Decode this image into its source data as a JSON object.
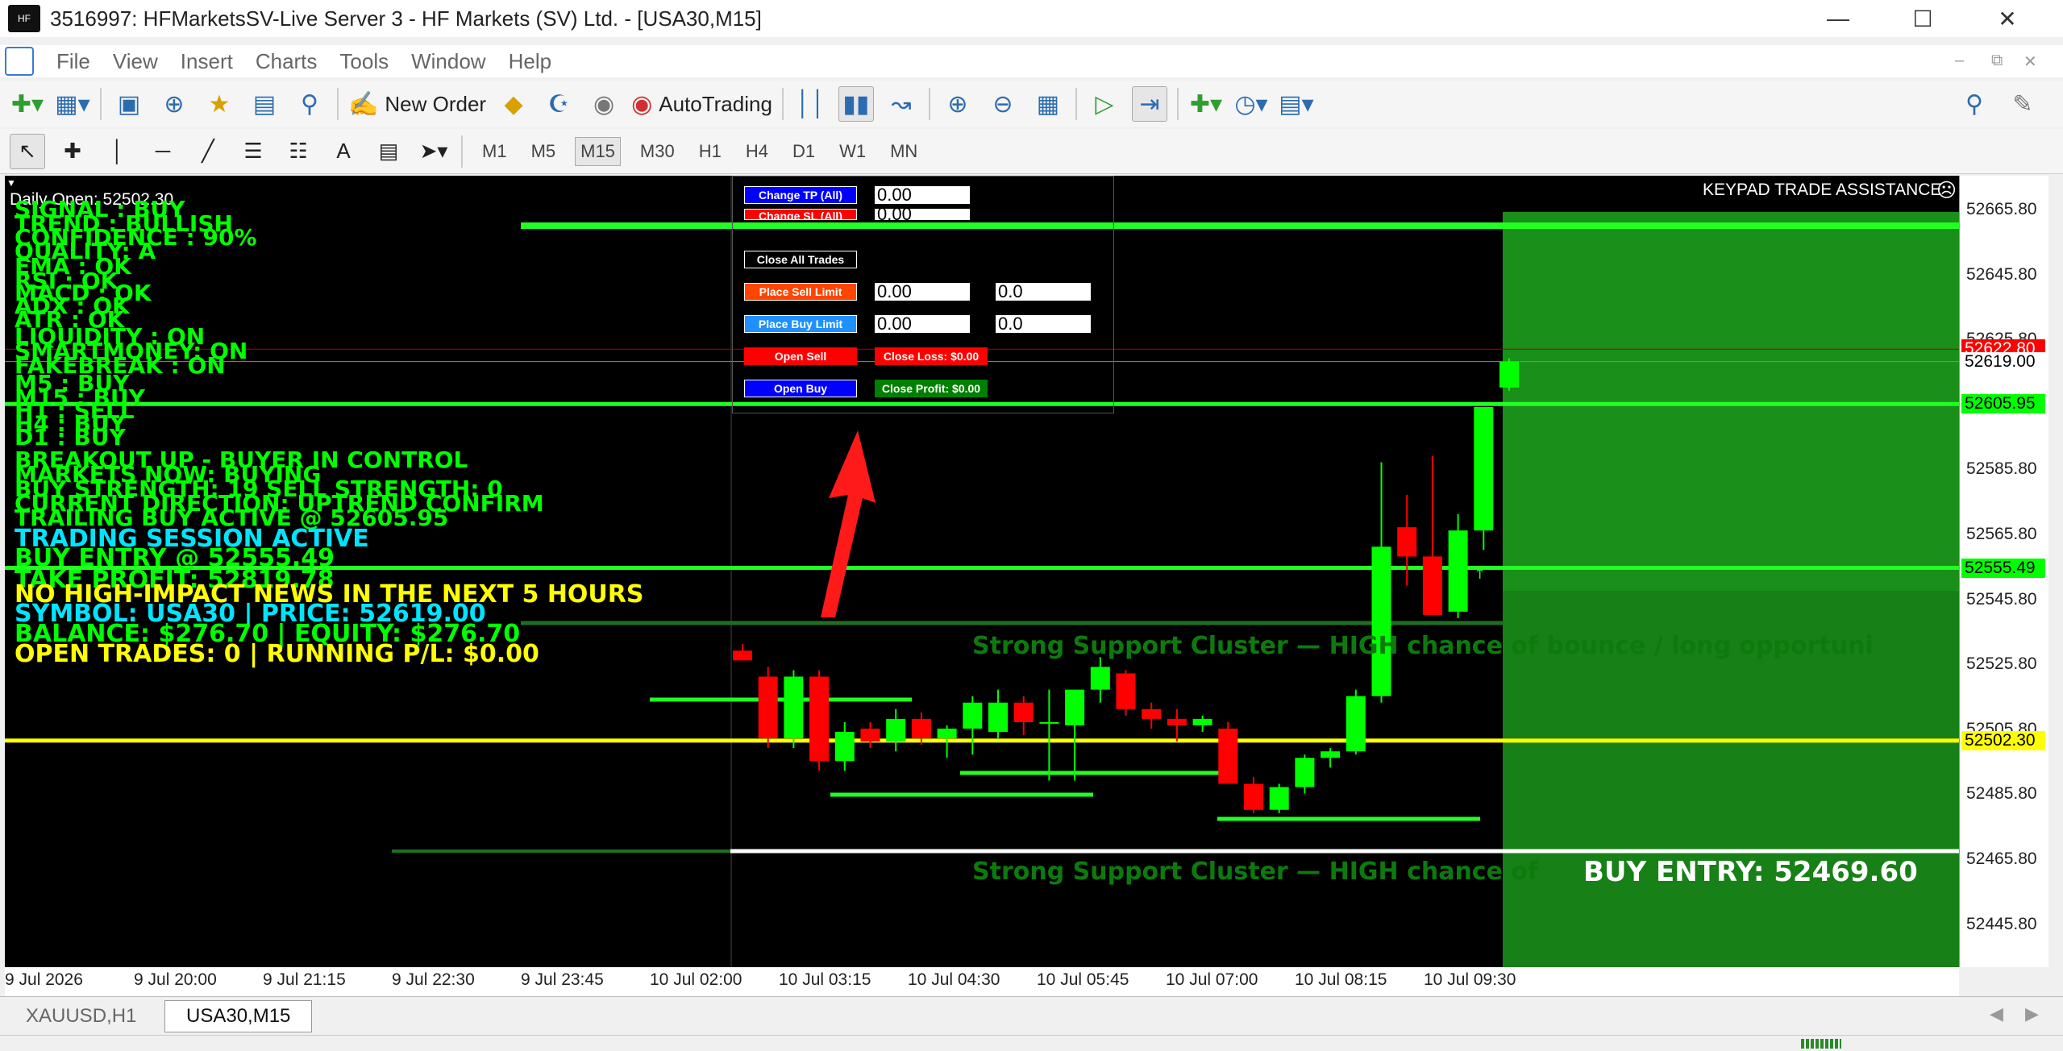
{
  "window": {
    "title": "3516997: HFMarketsSV-Live Server 3 - HF Markets (SV) Ltd. - [USA30,M15]"
  },
  "menu": {
    "items": [
      "File",
      "View",
      "Insert",
      "Charts",
      "Tools",
      "Window",
      "Help"
    ]
  },
  "toolbar": {
    "new_order": "New Order",
    "auto_trading": "AutoTrading"
  },
  "timeframes": [
    "M1",
    "M5",
    "M15",
    "M30",
    "H1",
    "H4",
    "D1",
    "W1",
    "MN"
  ],
  "timeframe_active": "M15",
  "chart": {
    "daily_open": "Daily Open: 52502.30",
    "keypad_title": "KEYPAD TRADE ASSISTANCE",
    "indicator_lines": [
      {
        "text": "SIGNAL : BUY",
        "color": "#00ff00"
      },
      {
        "text": "TREND  : BULLISH",
        "color": "#00ff00"
      },
      {
        "text": "CONFIDENCE  : 90%",
        "color": "#00ff00"
      },
      {
        "text": "QUALITY: A",
        "color": "#00ff00"
      },
      {
        "text": "EMA    : OK",
        "color": "#00ff00"
      },
      {
        "text": "RSI    : OK",
        "color": "#00ff00"
      },
      {
        "text": "MACD   : OK",
        "color": "#00ff00"
      },
      {
        "text": "ADX    : OK",
        "color": "#00ff00"
      },
      {
        "text": "ATR    : OK",
        "color": "#00ff00"
      },
      {
        "text": "LIQUIDITY : ON",
        "color": "#00ff00"
      },
      {
        "text": "SMARTMONEY: ON",
        "color": "#00ff00"
      },
      {
        "text": "FAKEBREAK : ON",
        "color": "#00ff00"
      },
      {
        "text": "M5  : BUY",
        "color": "#00ff00"
      },
      {
        "text": "M15 : BUY",
        "color": "#00ff00"
      },
      {
        "text": "H1  : SELL",
        "color": "#00ff00"
      },
      {
        "text": "H4  : BUY",
        "color": "#00ff00"
      },
      {
        "text": "D1  : BUY",
        "color": "#00ff00"
      },
      {
        "text": "BREAKOUT UP - BUYER IN CONTROL",
        "color": "#00ff00"
      },
      {
        "text": "MARKETS NOW: BUYING",
        "color": "#00ff00"
      },
      {
        "text": "BUY STRENGTH: 19   SELL STRENGTH: 0",
        "color": "#00ff00"
      },
      {
        "text": "CURRENT DIRECTION: UPTREND CONFIRM",
        "color": "#00ff00"
      },
      {
        "text": "TRAILING BUY ACTIVE @ 52605.95",
        "color": "#00ff00"
      },
      {
        "text": "TRADING SESSION ACTIVE",
        "color": "#00e5ff"
      },
      {
        "text": " BUY ENTRY @ 52555.49",
        "color": "#00ff00"
      },
      {
        "text": "TAKE PROFIT: 52819.78",
        "color": "#00ff00"
      },
      {
        "text": "NO HIGH-IMPACT NEWS IN THE NEXT 5 HOURS",
        "color": "#ffff00"
      },
      {
        "text": "SYMBOL: USA30 | PRICE: 52619.00",
        "color": "#00e5ff"
      },
      {
        "text": "BALANCE: $276.70 | EQUITY: $276.70",
        "color": "#00ff00"
      },
      {
        "text": "OPEN TRADES: 0 | RUNNING P/L: $0.00",
        "color": "#ffff00"
      }
    ],
    "panel": {
      "change_tp": "Change TP (All)",
      "change_sl": "Change SL (All)",
      "close_all": "Close All Trades",
      "place_sell_limit": "Place Sell Limit",
      "place_buy_limit": "Place Buy Limit",
      "open_sell": "Open Sell",
      "open_buy": "Open Buy",
      "close_loss": "Close Loss: $0.00",
      "close_profit": "Close Profit: $0.00",
      "tp_value": "0.00",
      "sl_value": "0.00",
      "sell_limit_price": "0.00",
      "sell_limit_lot": "0.0",
      "buy_limit_price": "0.00",
      "buy_limit_lot": "0.0"
    },
    "support_text": "Strong Support Cluster — HIGH chance of bounce / long opportuni",
    "support_text2": "Strong Support Cluster — HIGH chance of",
    "buy_entry_label": "BUY ENTRY: 52469.60"
  },
  "price_axis": {
    "labels": [
      "52665.80",
      "52645.80",
      "52625.80",
      "52585.80",
      "52565.80",
      "52545.80",
      "52525.80",
      "52505.80",
      "52485.80",
      "52465.80",
      "52445.80"
    ],
    "tags": [
      {
        "text": "52622.80",
        "bg": "#ff0000",
        "fg": "#ffffff"
      },
      {
        "text": "52619.00",
        "bg": "#ffffff",
        "fg": "#000000"
      },
      {
        "text": "52605.95",
        "bg": "#00ff00",
        "fg": "#000000"
      },
      {
        "text": "52555.49",
        "bg": "#00ff00",
        "fg": "#000000"
      },
      {
        "text": "52502.30",
        "bg": "#ffff00",
        "fg": "#000000"
      }
    ]
  },
  "time_axis": {
    "labels": [
      "9 Jul 2026",
      "9 Jul 20:00",
      "9 Jul 21:15",
      "9 Jul 22:30",
      "9 Jul 23:45",
      "10 Jul 02:00",
      "10 Jul 03:15",
      "10 Jul 04:30",
      "10 Jul 05:45",
      "10 Jul 07:00",
      "10 Jul 08:15",
      "10 Jul 09:30"
    ]
  },
  "chart_tabs": [
    "XAUUSD,H1",
    "USA30,M15"
  ],
  "candles": [
    {
      "o": 52530,
      "h": 52532,
      "l": 52527,
      "c": 52527
    },
    {
      "o": 52522,
      "h": 52525,
      "l": 52500,
      "c": 52503
    },
    {
      "o": 52503,
      "h": 52524,
      "l": 52500,
      "c": 52522
    },
    {
      "o": 52522,
      "h": 52524,
      "l": 52493,
      "c": 52496
    },
    {
      "o": 52496,
      "h": 52508,
      "l": 52493,
      "c": 52505
    },
    {
      "o": 52506,
      "h": 52508,
      "l": 52500,
      "c": 52502
    },
    {
      "o": 52502,
      "h": 52512,
      "l": 52499,
      "c": 52509
    },
    {
      "o": 52509,
      "h": 52511,
      "l": 52501,
      "c": 52503
    },
    {
      "o": 52503,
      "h": 52507,
      "l": 52497,
      "c": 52506
    },
    {
      "o": 52506,
      "h": 52516,
      "l": 52498,
      "c": 52514
    },
    {
      "o": 52505,
      "h": 52518,
      "l": 52503,
      "c": 52514
    },
    {
      "o": 52514,
      "h": 52516,
      "l": 52504,
      "c": 52508
    },
    {
      "o": 52508,
      "h": 52518,
      "l": 52490,
      "c": 52508
    },
    {
      "o": 52507,
      "h": 52518,
      "l": 52490,
      "c": 52518
    },
    {
      "o": 52518,
      "h": 52528,
      "l": 52514,
      "c": 52525
    },
    {
      "o": 52523,
      "h": 52524,
      "l": 52510,
      "c": 52512
    },
    {
      "o": 52512,
      "h": 52514,
      "l": 52506,
      "c": 52509
    },
    {
      "o": 52509,
      "h": 52512,
      "l": 52502,
      "c": 52507
    },
    {
      "o": 52507,
      "h": 52510,
      "l": 52505,
      "c": 52509
    },
    {
      "o": 52506,
      "h": 52508,
      "l": 52490,
      "c": 52489
    },
    {
      "o": 52489,
      "h": 52491,
      "l": 52480,
      "c": 52481
    },
    {
      "o": 52481,
      "h": 52489,
      "l": 52480,
      "c": 52488
    },
    {
      "o": 52488,
      "h": 52498,
      "l": 52486,
      "c": 52497
    },
    {
      "o": 52497,
      "h": 52500,
      "l": 52494,
      "c": 52499
    },
    {
      "o": 52499,
      "h": 52518,
      "l": 52498,
      "c": 52516
    },
    {
      "o": 52516,
      "h": 52588,
      "l": 52514,
      "c": 52562
    },
    {
      "o": 52568,
      "h": 52578,
      "l": 52550,
      "c": 52559
    },
    {
      "o": 52559,
      "h": 52590,
      "l": 52543,
      "c": 52541
    },
    {
      "o": 52542,
      "h": 52572,
      "l": 52540,
      "c": 52567
    },
    {
      "o": 52567,
      "h": 52605,
      "l": 52561,
      "c": 52605
    },
    {
      "o": 52611,
      "h": 52620,
      "l": 52610,
      "c": 52619
    }
  ],
  "colors": {
    "bull": "#00ff00",
    "bear": "#ff0000",
    "zone": "#1a8f1a",
    "support": "#00ff00",
    "yellow_line": "#ffff00"
  }
}
